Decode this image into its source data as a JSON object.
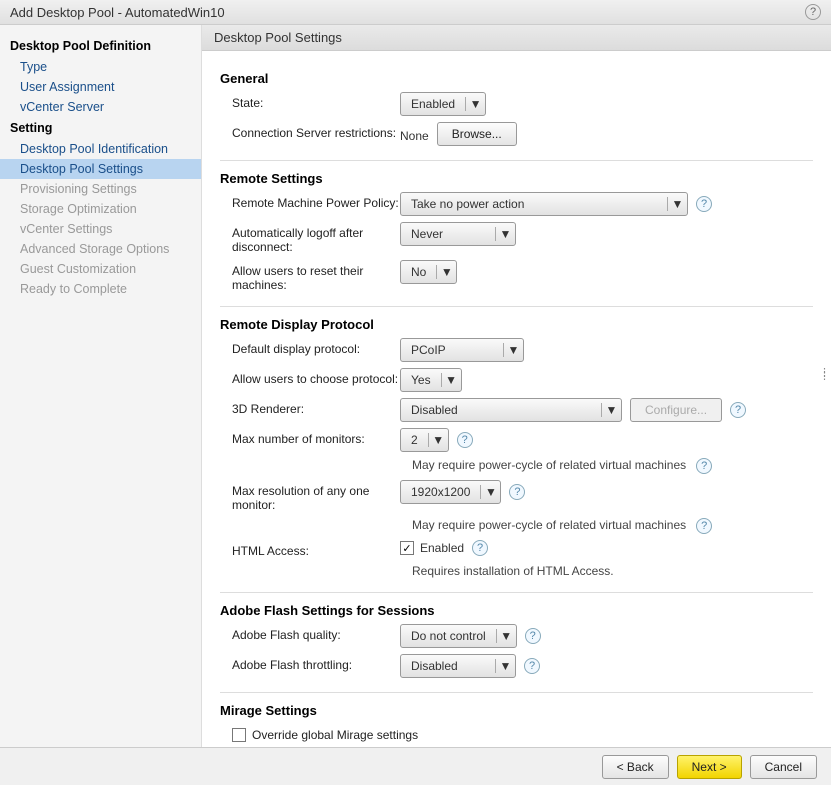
{
  "title": "Add Desktop Pool - AutomatedWin10",
  "sidebar": {
    "group1_title": "Desktop Pool Definition",
    "group1": [
      {
        "label": "Type"
      },
      {
        "label": "User Assignment"
      },
      {
        "label": "vCenter Server"
      }
    ],
    "group2_title": "Setting",
    "group2": [
      {
        "label": "Desktop Pool Identification",
        "state": "link"
      },
      {
        "label": "Desktop Pool Settings",
        "state": "active"
      },
      {
        "label": "Provisioning Settings",
        "state": "disabled"
      },
      {
        "label": "Storage Optimization",
        "state": "disabled"
      },
      {
        "label": "vCenter Settings",
        "state": "disabled"
      },
      {
        "label": "Advanced Storage Options",
        "state": "disabled"
      },
      {
        "label": "Guest Customization",
        "state": "disabled"
      },
      {
        "label": "Ready to Complete",
        "state": "disabled"
      }
    ]
  },
  "content_header": "Desktop Pool Settings",
  "sections": {
    "general": {
      "title": "General",
      "state_label": "State:",
      "state_value": "Enabled",
      "conn_label": "Connection Server restrictions:",
      "conn_value": "None",
      "browse": "Browse..."
    },
    "remote": {
      "title": "Remote Settings",
      "power_label": "Remote Machine Power Policy:",
      "power_value": "Take no power action",
      "logoff_label": "Automatically logoff after disconnect:",
      "logoff_value": "Never",
      "reset_label": "Allow users to reset their machines:",
      "reset_value": "No"
    },
    "display": {
      "title": "Remote Display Protocol",
      "default_label": "Default display protocol:",
      "default_value": "PCoIP",
      "choose_label": "Allow users to choose protocol:",
      "choose_value": "Yes",
      "render_label": "3D Renderer:",
      "render_value": "Disabled",
      "configure": "Configure...",
      "monitors_label": "Max number of monitors:",
      "monitors_value": "2",
      "monitors_note": "May require power-cycle of related virtual machines",
      "res_label": "Max resolution of any one monitor:",
      "res_value": "1920x1200",
      "res_note": "May require power-cycle of related virtual machines",
      "html_label": "HTML Access:",
      "html_check": "Enabled",
      "html_note": "Requires installation of HTML Access."
    },
    "flash": {
      "title": "Adobe Flash Settings for Sessions",
      "quality_label": "Adobe Flash quality:",
      "quality_value": "Do not control",
      "throttle_label": "Adobe Flash throttling:",
      "throttle_value": "Disabled"
    },
    "mirage": {
      "title": "Mirage Settings",
      "override": "Override global Mirage settings"
    }
  },
  "footer": {
    "back": "< Back",
    "next": "Next >",
    "cancel": "Cancel"
  }
}
